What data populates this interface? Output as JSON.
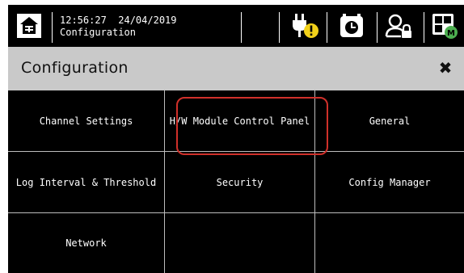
{
  "status_bar": {
    "time": "12:56:27",
    "date": "24/04/2019",
    "screen_name": "Configuration",
    "icons": [
      "home-icon",
      "power-warning-icon",
      "scheduler-clock-icon",
      "user-lock-icon",
      "modules-status-icon"
    ],
    "warning_badge_color": "#f2d11a",
    "modules_badge_color": "#4caf50"
  },
  "header": {
    "title": "Configuration",
    "close_symbol": "✖"
  },
  "grid": {
    "items": [
      {
        "label": "Channel Settings"
      },
      {
        "label": "H/W Module Control Panel",
        "highlighted": true
      },
      {
        "label": "General"
      },
      {
        "label": "Log Interval & Threshold"
      },
      {
        "label": "Security"
      },
      {
        "label": "Config Manager"
      },
      {
        "label": "Network"
      },
      {
        "label": ""
      },
      {
        "label": ""
      }
    ]
  },
  "colors": {
    "background": "#000000",
    "header_band": "#c9c9c9",
    "grid_lines": "#bdbdbd",
    "highlight_ring": "#d0302a"
  }
}
